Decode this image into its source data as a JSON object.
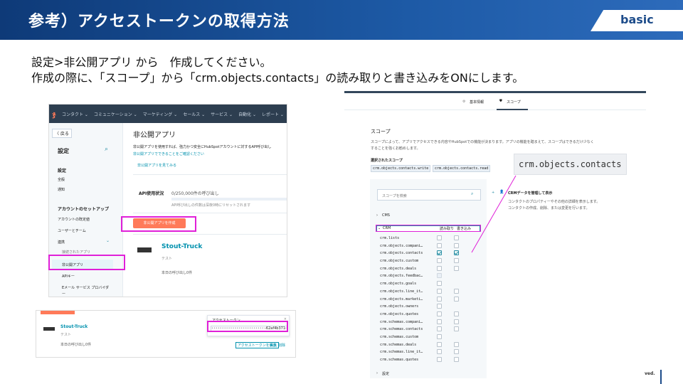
{
  "header": {
    "title": "参考）アクセストークンの取得方法",
    "badge": "basic"
  },
  "instructions": {
    "line1": "設定>非公開アプリ から　作成してください。",
    "line2": "作成の際に、「スコープ」から「crm.objects.contacts」の読み取りと書き込みをONにします。"
  },
  "hubspot": {
    "topnav": [
      "コンタクト ⌄",
      "コミュニケーション ⌄",
      "マーケティング ⌄",
      "セールス ⌄",
      "サービス ⌄",
      "自動化 ⌄",
      "レポート ⌄"
    ],
    "back": "〈 戻る",
    "settings_title": "設定",
    "sidebar": {
      "sec1": "設定",
      "item1": "全般",
      "item2": "通知",
      "sec2": "アカウントのセットアップ",
      "item3": "アカウントの既定値",
      "item4": "ユーザーとチーム",
      "item5": "連携",
      "item6": "接続されたアプリ",
      "item7": "非公開アプリ",
      "item8": "APIキー",
      "item9": "Eメール サービス プロバイダー"
    },
    "main_title": "非公開アプリ",
    "desc1": "非公開アプリを使用すれば、強力かつ安全にHubSpotアカウントに対するAPI呼び出し",
    "desc2": "非公開アプリでできることをご確認ください",
    "view_link": "非公開アプリを見てみる",
    "api_label": "API使用状況",
    "api_value": "0/250,000件の呼び出し",
    "api_note": "API呼び出しの件数は深夜0時にリセットされます",
    "create_button": "非公開アプリを作成",
    "app_name": "Stout-Truck",
    "app_tag": "テスト",
    "app_calls": "本日の呼び出し0件"
  },
  "token": {
    "strip": "",
    "app_name": "Stout-Truck",
    "app_tag": "テスト",
    "app_calls": "本日の呼び出し0件",
    "popup_title": "アクセストークン",
    "token_mask": "••••••••••••••••••••••••••••••••••••••••••••",
    "token_suffix": "-62af4b371",
    "show_button": "アクセストークンを表示",
    "edit": "編集",
    "delete": "削除"
  },
  "scopes": {
    "tab1": "基本情報",
    "tab2": "スコープ",
    "heading": "スコープ",
    "desc1": "スコープによって、アプリでアクセスできる内容やHubSpotでの機能が決まります。アプリの機能を踏まえて、スコープはできるだけ少なく",
    "desc2": "することを強くお勧めします。",
    "selected_label": "選択されたスコープ",
    "chips": [
      "crm.objects.contacts.write",
      "crm.objects.contacts.read"
    ],
    "callout": "crm.objects.contacts",
    "search_placeholder": "スコープを検索",
    "cms": "CMS",
    "crm": "CRM",
    "col_read": "読み取り",
    "col_write": "書き込み",
    "rows": [
      {
        "name": "crm.lists",
        "read": "off",
        "write": "off"
      },
      {
        "name": "crm.objects.compani…",
        "read": "off",
        "write": "off"
      },
      {
        "name": "crm.objects.contacts",
        "read": "on",
        "write": "on"
      },
      {
        "name": "crm.objects.custom",
        "read": "off",
        "write": "off"
      },
      {
        "name": "crm.objects.deals",
        "read": "off",
        "write": "off"
      },
      {
        "name": "crm.objects.feedbac…",
        "read": "dis",
        "write": "none"
      },
      {
        "name": "crm.objects.goals",
        "read": "off",
        "write": "none"
      },
      {
        "name": "crm.objects.line_it…",
        "read": "off",
        "write": "off"
      },
      {
        "name": "crm.objects.marketi…",
        "read": "off",
        "write": "off"
      },
      {
        "name": "crm.objects.owners",
        "read": "off",
        "write": "none"
      },
      {
        "name": "crm.objects.quotes",
        "read": "off",
        "write": "off"
      },
      {
        "name": "crm.schemas.compani…",
        "read": "off",
        "write": "off"
      },
      {
        "name": "crm.schemas.contacts",
        "read": "off",
        "write": "off"
      },
      {
        "name": "crm.schemas.custom",
        "read": "off",
        "write": "none"
      },
      {
        "name": "crm.schemas.deals",
        "read": "off",
        "write": "off"
      },
      {
        "name": "crm.schemas.line_it…",
        "read": "off",
        "write": "off"
      },
      {
        "name": "crm.schemas.quotes",
        "read": "off",
        "write": "off"
      }
    ],
    "settings": "設定",
    "detail_title": "CRMデータを管理して表示",
    "detail1": "コンタクトのプロパティーやその他の詳細を表示します。",
    "detail2": "コンタクトの作成、削除、または変更を行います。"
  },
  "footer": {
    "copyright": "ved."
  },
  "colors": {
    "accent": "#e020d8",
    "hubspot_orange": "#ff7a59",
    "nav_dark": "#2d3e50",
    "teal": "#2b8fa6"
  }
}
